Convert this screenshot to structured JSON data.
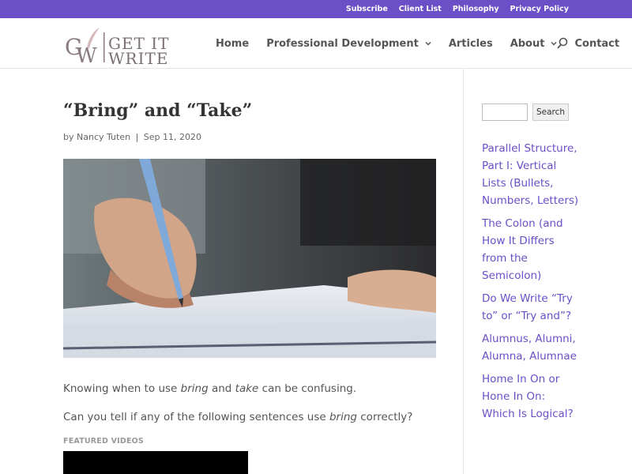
{
  "topbar": {
    "links": [
      "Subscribe",
      "Client List",
      "Philosophy",
      "Privacy Policy"
    ]
  },
  "header": {
    "logo_text": "GET IT WRITE",
    "nav": [
      {
        "label": "Home",
        "dropdown": false
      },
      {
        "label": "Professional Development",
        "dropdown": true
      },
      {
        "label": "Articles",
        "dropdown": false
      },
      {
        "label": "About",
        "dropdown": true
      },
      {
        "label": "Contact",
        "dropdown": false
      }
    ]
  },
  "post": {
    "title": "“Bring” and “Take”",
    "by": "by",
    "author": "Nancy Tuten",
    "date": "Sep 11, 2020",
    "p1": {
      "a": "Knowing when to use ",
      "b": "bring",
      "c": " and ",
      "d": "take",
      "e": " can be confusing."
    },
    "p2": {
      "a": "Can you tell if any of the following sentences use ",
      "b": "bring",
      "c": " correctly?"
    },
    "featured_videos": "FEATURED VIDEOS"
  },
  "sidebar": {
    "search_button": "Search",
    "search_placeholder": "",
    "recent_posts": [
      "Parallel Structure, Part I: Vertical Lists (Bullets, Numbers, Letters)",
      "The Colon (and How It Differs from the Semicolon)",
      "Do We Write “Try to” or “Try and”?",
      "Alumnus, Alumni, Alumna, Alumnae",
      "Home In On or Hone In On: Which Is Logical?"
    ]
  },
  "colors": {
    "accent": "#6a4fc7",
    "topbar": "#6a4fc7"
  }
}
